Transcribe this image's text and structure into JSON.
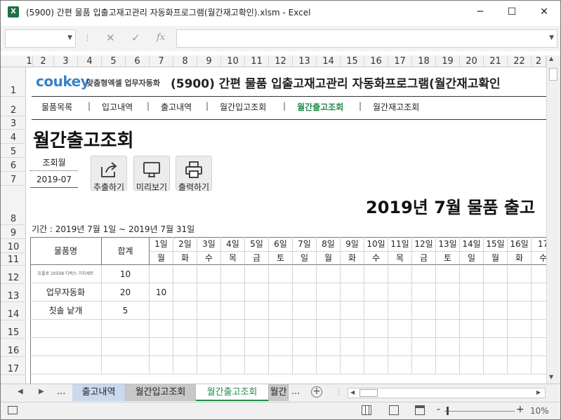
{
  "titlebar": {
    "app_icon": "X",
    "title": "(5900) 간편 물품 입출고재고관리 자동화프로그램(월간재고확인).xlsm  -  Excel",
    "minimize": "─",
    "maximize": "☐",
    "close": "✕"
  },
  "formula_bar": {
    "name_box": "",
    "cancel_icon": "✕",
    "enter_icon": "✓",
    "fx_icon": "fx",
    "formula": ""
  },
  "columns": [
    "1",
    "2",
    "3",
    "4",
    "5",
    "6",
    "7",
    "8",
    "9",
    "10",
    "11",
    "12",
    "13",
    "14",
    "15",
    "16",
    "17",
    "18",
    "19",
    "20",
    "21",
    "22",
    "2"
  ],
  "rows": [
    "1",
    "2",
    "3",
    "4",
    "5",
    "6",
    "7",
    "8",
    "9",
    "10",
    "11",
    "12",
    "13",
    "14",
    "15",
    "16",
    "17"
  ],
  "header": {
    "logo_text": "coukey",
    "logo_sub": "맞춤형엑셀 업무자동화",
    "title": "(5900) 간편 물품 입출고재고관리 자동화프로그램(월간재고확인"
  },
  "nav": {
    "items": [
      {
        "label": "물품목록",
        "active": false
      },
      {
        "label": "입고내역",
        "active": false
      },
      {
        "label": "출고내역",
        "active": false
      },
      {
        "label": "월간입고조회",
        "active": false
      },
      {
        "label": "월간출고조회",
        "active": true
      },
      {
        "label": "월간재고조회",
        "active": false
      }
    ],
    "separator": "|"
  },
  "page": {
    "heading": "월간출고조회",
    "query_month_label": "조회월",
    "query_month_value": "2019-07",
    "buttons": {
      "export": "추출하기",
      "preview": "미리보기",
      "print": "출력하기"
    },
    "report_title": "2019년 7월 물품 출고",
    "period": "기간 : 2019년 7월 1일 ~ 2019년 7월 31일"
  },
  "table": {
    "col_item": "물품명",
    "col_total": "합계",
    "days": [
      "1일",
      "2일",
      "3일",
      "4일",
      "5일",
      "6일",
      "7일",
      "8일",
      "9일",
      "10일",
      "11일",
      "12일",
      "13일",
      "14일",
      "15일",
      "16일",
      "17"
    ],
    "weekdays": [
      "월",
      "화",
      "수",
      "목",
      "금",
      "토",
      "일",
      "월",
      "화",
      "수",
      "목",
      "금",
      "토",
      "일",
      "월",
      "화",
      "수"
    ],
    "rows": [
      {
        "item": "듀플로 10508 디럭스 기차세트",
        "total": "10",
        "day1": ""
      },
      {
        "item": "업무자동화",
        "total": "20",
        "day1": "10"
      },
      {
        "item": "칫솔 낱개",
        "total": "5",
        "day1": ""
      }
    ]
  },
  "sheet_tabs": {
    "prev": "◀",
    "next": "▶",
    "more": "...",
    "tabs": [
      {
        "label": "출고내역",
        "color": "#c9d9ef",
        "active": false
      },
      {
        "label": "월간입고조회",
        "color": "#c8c8c8",
        "active": false
      },
      {
        "label": "월간출고조회",
        "color": "#ffffff",
        "active": true
      },
      {
        "label": "월간",
        "color": "#c8c8c8",
        "active": false
      }
    ],
    "more2": "...",
    "add": "+"
  },
  "statusbar": {
    "zoom": "10%",
    "zoom_minus": "-",
    "zoom_plus": "+"
  },
  "colors": {
    "accent_green": "#1e8c45",
    "excel_green": "#1e7145",
    "logo_blue": "#3a82c4",
    "logo_green": "#8dc63f"
  }
}
